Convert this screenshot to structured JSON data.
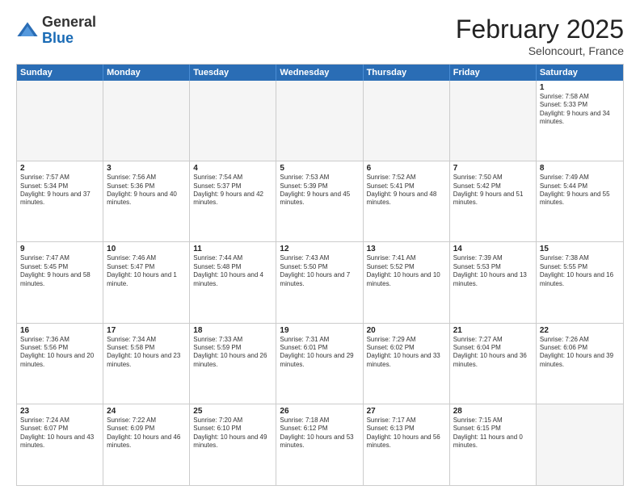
{
  "logo": {
    "general": "General",
    "blue": "Blue"
  },
  "title": "February 2025",
  "location": "Seloncourt, France",
  "header_days": [
    "Sunday",
    "Monday",
    "Tuesday",
    "Wednesday",
    "Thursday",
    "Friday",
    "Saturday"
  ],
  "weeks": [
    [
      {
        "day": "",
        "text": "",
        "empty": true
      },
      {
        "day": "",
        "text": "",
        "empty": true
      },
      {
        "day": "",
        "text": "",
        "empty": true
      },
      {
        "day": "",
        "text": "",
        "empty": true
      },
      {
        "day": "",
        "text": "",
        "empty": true
      },
      {
        "day": "",
        "text": "",
        "empty": true
      },
      {
        "day": "1",
        "text": "Sunrise: 7:58 AM\nSunset: 5:33 PM\nDaylight: 9 hours and 34 minutes.",
        "empty": false
      }
    ],
    [
      {
        "day": "2",
        "text": "Sunrise: 7:57 AM\nSunset: 5:34 PM\nDaylight: 9 hours and 37 minutes.",
        "empty": false
      },
      {
        "day": "3",
        "text": "Sunrise: 7:56 AM\nSunset: 5:36 PM\nDaylight: 9 hours and 40 minutes.",
        "empty": false
      },
      {
        "day": "4",
        "text": "Sunrise: 7:54 AM\nSunset: 5:37 PM\nDaylight: 9 hours and 42 minutes.",
        "empty": false
      },
      {
        "day": "5",
        "text": "Sunrise: 7:53 AM\nSunset: 5:39 PM\nDaylight: 9 hours and 45 minutes.",
        "empty": false
      },
      {
        "day": "6",
        "text": "Sunrise: 7:52 AM\nSunset: 5:41 PM\nDaylight: 9 hours and 48 minutes.",
        "empty": false
      },
      {
        "day": "7",
        "text": "Sunrise: 7:50 AM\nSunset: 5:42 PM\nDaylight: 9 hours and 51 minutes.",
        "empty": false
      },
      {
        "day": "8",
        "text": "Sunrise: 7:49 AM\nSunset: 5:44 PM\nDaylight: 9 hours and 55 minutes.",
        "empty": false
      }
    ],
    [
      {
        "day": "9",
        "text": "Sunrise: 7:47 AM\nSunset: 5:45 PM\nDaylight: 9 hours and 58 minutes.",
        "empty": false
      },
      {
        "day": "10",
        "text": "Sunrise: 7:46 AM\nSunset: 5:47 PM\nDaylight: 10 hours and 1 minute.",
        "empty": false
      },
      {
        "day": "11",
        "text": "Sunrise: 7:44 AM\nSunset: 5:48 PM\nDaylight: 10 hours and 4 minutes.",
        "empty": false
      },
      {
        "day": "12",
        "text": "Sunrise: 7:43 AM\nSunset: 5:50 PM\nDaylight: 10 hours and 7 minutes.",
        "empty": false
      },
      {
        "day": "13",
        "text": "Sunrise: 7:41 AM\nSunset: 5:52 PM\nDaylight: 10 hours and 10 minutes.",
        "empty": false
      },
      {
        "day": "14",
        "text": "Sunrise: 7:39 AM\nSunset: 5:53 PM\nDaylight: 10 hours and 13 minutes.",
        "empty": false
      },
      {
        "day": "15",
        "text": "Sunrise: 7:38 AM\nSunset: 5:55 PM\nDaylight: 10 hours and 16 minutes.",
        "empty": false
      }
    ],
    [
      {
        "day": "16",
        "text": "Sunrise: 7:36 AM\nSunset: 5:56 PM\nDaylight: 10 hours and 20 minutes.",
        "empty": false
      },
      {
        "day": "17",
        "text": "Sunrise: 7:34 AM\nSunset: 5:58 PM\nDaylight: 10 hours and 23 minutes.",
        "empty": false
      },
      {
        "day": "18",
        "text": "Sunrise: 7:33 AM\nSunset: 5:59 PM\nDaylight: 10 hours and 26 minutes.",
        "empty": false
      },
      {
        "day": "19",
        "text": "Sunrise: 7:31 AM\nSunset: 6:01 PM\nDaylight: 10 hours and 29 minutes.",
        "empty": false
      },
      {
        "day": "20",
        "text": "Sunrise: 7:29 AM\nSunset: 6:02 PM\nDaylight: 10 hours and 33 minutes.",
        "empty": false
      },
      {
        "day": "21",
        "text": "Sunrise: 7:27 AM\nSunset: 6:04 PM\nDaylight: 10 hours and 36 minutes.",
        "empty": false
      },
      {
        "day": "22",
        "text": "Sunrise: 7:26 AM\nSunset: 6:06 PM\nDaylight: 10 hours and 39 minutes.",
        "empty": false
      }
    ],
    [
      {
        "day": "23",
        "text": "Sunrise: 7:24 AM\nSunset: 6:07 PM\nDaylight: 10 hours and 43 minutes.",
        "empty": false
      },
      {
        "day": "24",
        "text": "Sunrise: 7:22 AM\nSunset: 6:09 PM\nDaylight: 10 hours and 46 minutes.",
        "empty": false
      },
      {
        "day": "25",
        "text": "Sunrise: 7:20 AM\nSunset: 6:10 PM\nDaylight: 10 hours and 49 minutes.",
        "empty": false
      },
      {
        "day": "26",
        "text": "Sunrise: 7:18 AM\nSunset: 6:12 PM\nDaylight: 10 hours and 53 minutes.",
        "empty": false
      },
      {
        "day": "27",
        "text": "Sunrise: 7:17 AM\nSunset: 6:13 PM\nDaylight: 10 hours and 56 minutes.",
        "empty": false
      },
      {
        "day": "28",
        "text": "Sunrise: 7:15 AM\nSunset: 6:15 PM\nDaylight: 11 hours and 0 minutes.",
        "empty": false
      },
      {
        "day": "",
        "text": "",
        "empty": true
      }
    ]
  ]
}
